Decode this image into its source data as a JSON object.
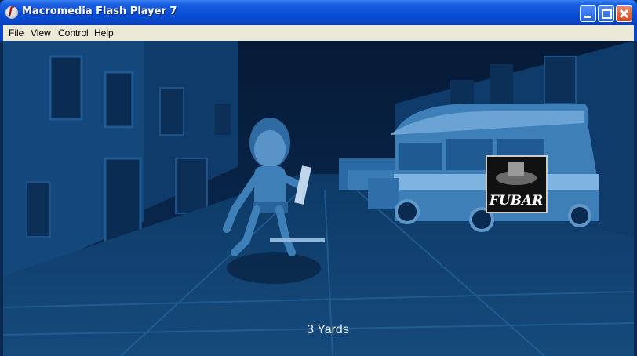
{
  "window": {
    "title": "Macromedia Flash Player 7"
  },
  "menu": {
    "items": [
      "File",
      "View",
      "Control",
      "Help"
    ]
  },
  "game": {
    "yards_text": "3 Yards"
  },
  "colors": {
    "titlebar": "#0a4fd8",
    "menubar": "#ece9d8",
    "scene_night_blue": "#0b2a52"
  }
}
